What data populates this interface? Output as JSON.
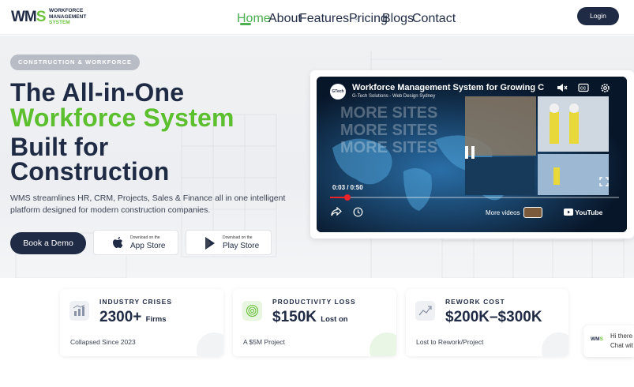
{
  "header": {
    "logo": {
      "mark_a": "WM",
      "mark_b": "S",
      "line1": "WORKFORCE",
      "line2": "MANAGEMENT",
      "line3": "SYSTEM"
    },
    "nav": [
      {
        "label": "Home",
        "active": true
      },
      {
        "label": "About"
      },
      {
        "label": "Features"
      },
      {
        "label": "Pricing"
      },
      {
        "label": "Blogs"
      },
      {
        "label": "Contact"
      }
    ],
    "login_label": "Login"
  },
  "hero": {
    "tag": "CONSTRUCTION & WORKFORCE",
    "title_line1": "The All-in-One",
    "title_line2": "Workforce System",
    "title_line3": "Built for",
    "title_line4": "Construction",
    "lede": "WMS streamlines HR, CRM, Projects, Sales & Finance all in one intelligent platform designed for modern construction companies.",
    "demo_label": "Book a Demo",
    "app_store": {
      "small": "Download on the",
      "big": "App Store"
    },
    "play_store": {
      "small": "Download on the",
      "big": "Play Store"
    }
  },
  "video": {
    "title": "Workforce Management System for Growing C",
    "channel": "G-Tech Solutions - Web Design Sydney",
    "avatar_text": "GTech",
    "time": "0:03 / 0:50",
    "progress": 0.06,
    "overlay_text": [
      "MORE SITES",
      "MORE SITES",
      "MORE SITES"
    ],
    "more_videos": "More videos",
    "youtube": "YouTube"
  },
  "cards": [
    {
      "label": "INDUSTRY CRISES",
      "value": "2300+",
      "unit": "Firms",
      "foot": "Collapsed Since 2023",
      "icon": "bar-chart-icon"
    },
    {
      "label": "PRODUCTIVITY LOSS",
      "value": "$150K",
      "unit": "Lost on",
      "foot": "A $5M Project",
      "icon": "fingerprint-icon"
    },
    {
      "label": "REWORK COST",
      "value": "$200K–$300K",
      "unit": "",
      "foot": "Lost to Rework/Project",
      "icon": "trend-icon"
    }
  ],
  "chat": {
    "logo_a": "WM",
    "logo_b": "S",
    "line1": "Hi there",
    "line2": "Chat wit"
  },
  "colors": {
    "navy": "#1f2a44",
    "green": "#5bbf2e",
    "accent_red": "#e8232a"
  }
}
